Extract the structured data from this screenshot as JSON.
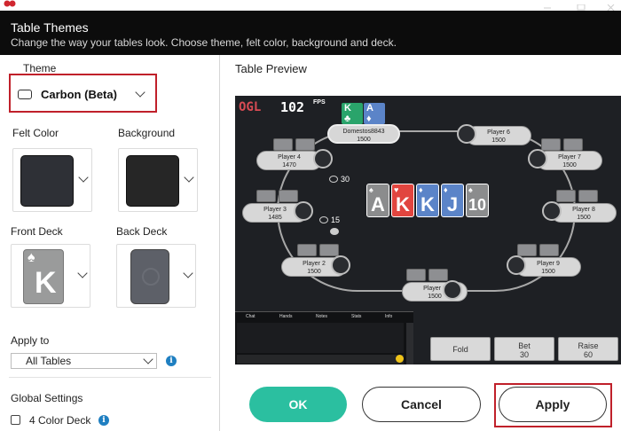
{
  "header": {
    "title": "Table Themes",
    "subtitle": "Change the way your tables look. Choose theme, felt color, background and deck."
  },
  "left": {
    "theme_label": "Theme",
    "theme_value": "Carbon (Beta)",
    "felt_label": "Felt Color",
    "felt_color": "#2e3036",
    "background_label": "Background",
    "background_color": "#262626",
    "front_deck_label": "Front Deck",
    "front_deck_card": "K",
    "back_deck_label": "Back Deck",
    "apply_to_label": "Apply to",
    "apply_to_value": "All Tables",
    "global_settings_label": "Global Settings",
    "four_color_label": "4 Color Deck"
  },
  "preview": {
    "title": "Table Preview",
    "brand": "OGL",
    "fps_value": "102",
    "fps_label": "FPS",
    "hero": {
      "name": "Domestos8843",
      "stack": "1500"
    },
    "players": [
      {
        "name": "Player 6",
        "stack": "1500"
      },
      {
        "name": "Player 4",
        "stack": "1470"
      },
      {
        "name": "Player 7",
        "stack": "1500"
      },
      {
        "name": "Player 3",
        "stack": "1485"
      },
      {
        "name": "Player 8",
        "stack": "1500"
      },
      {
        "name": "Player 2",
        "stack": "1500"
      },
      {
        "name": "Player 9",
        "stack": "1500"
      },
      {
        "name": "Player 1",
        "stack": "1500"
      }
    ],
    "bet_p4": "30",
    "bet_p3": "15",
    "hole_cards": [
      "K",
      "A"
    ],
    "board": [
      "A",
      "K",
      "K",
      "J",
      "10"
    ],
    "chat_tabs": [
      "Chat",
      "Hands",
      "Notes",
      "Stats",
      "Info"
    ],
    "actions": {
      "fold": "Fold",
      "bet_label": "Bet",
      "bet_amount": "30",
      "raise_label": "Raise",
      "raise_amount": "60"
    }
  },
  "buttons": {
    "ok": "OK",
    "cancel": "Cancel",
    "apply": "Apply"
  },
  "colors": {
    "ok": "#2bbfa0",
    "highlight": "#c0202a",
    "info": "#1f7fc1"
  }
}
